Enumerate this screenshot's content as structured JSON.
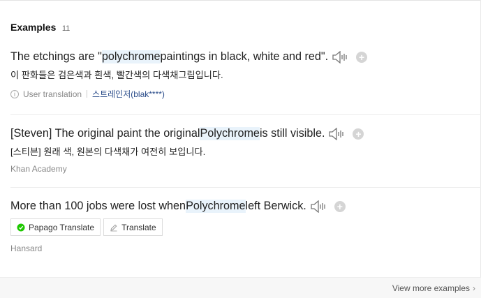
{
  "header": {
    "title": "Examples",
    "count": "11"
  },
  "examples": [
    {
      "pre": "The etchings are \"",
      "highlight": "polychrome",
      "post": " paintings in black, white and red\".",
      "translation": "이 판화들은 검은색과 흰색, 빨간색의 다색채그림입니다.",
      "meta_label": "User translation",
      "meta_user": "스트레인저(blak****)"
    },
    {
      "pre": "[Steven] The original paint the original ",
      "highlight": "Polychrome",
      "post": " is still visible.",
      "translation": "[스티븐] 원래 색, 원본의 다색채가 여전히 보입니다.",
      "source": "Khan Academy"
    },
    {
      "pre": "More than 100 jobs were lost when ",
      "highlight": "Polychrome",
      "post": " left Berwick.",
      "papago_label": "Papago Translate",
      "translate_label": "Translate",
      "source": "Hansard"
    }
  ],
  "footer": {
    "more_label": "View more examples"
  },
  "colors": {
    "highlight": "#e9f3fb",
    "user_link": "#2a4c8a",
    "papago_green": "#1ec800"
  }
}
